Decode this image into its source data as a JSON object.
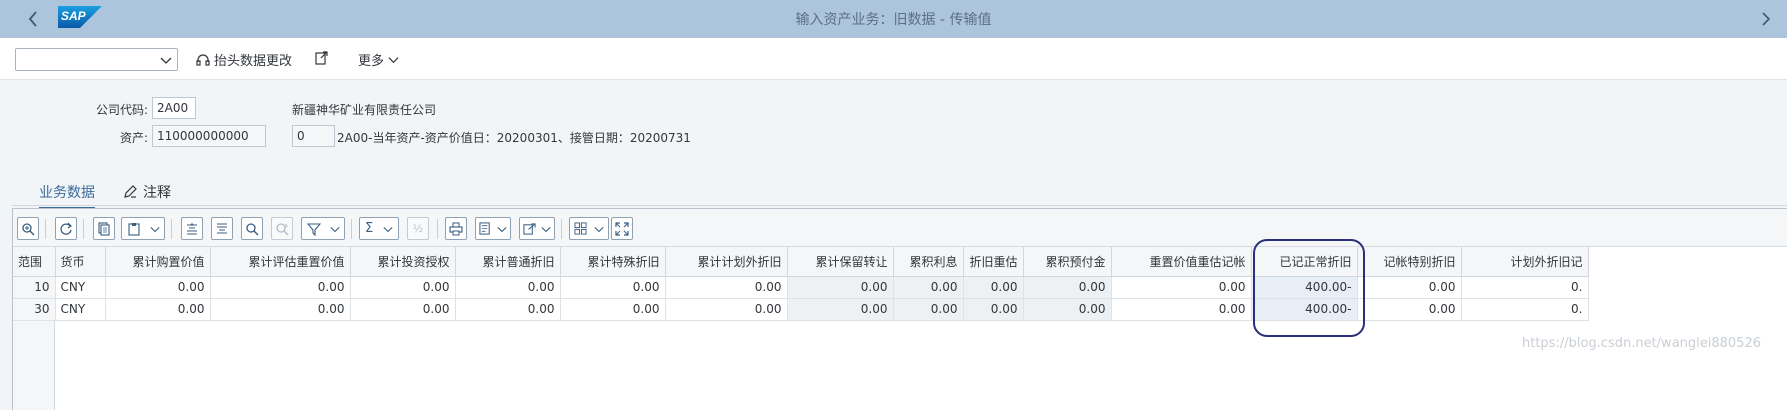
{
  "shell": {
    "title": "输入资产业务：旧数据 - 传输值",
    "logo": "SAP",
    "back_icon": "chevron-left-icon",
    "forward_icon": "chevron-right-icon"
  },
  "toolbar": {
    "dropdown_value": "",
    "header_change_label": "抬头数据更改",
    "more_label": "更多"
  },
  "form": {
    "company_code_label": "公司代码:",
    "company_code_value": "2A00",
    "company_name": "新疆神华矿业有限责任公司",
    "asset_label": "资产:",
    "asset_value": "110000000000",
    "sub_number": "0",
    "asset_desc": "2A00-当年资产-资产价值日：20200301、接管日期：20200731"
  },
  "tabs": [
    {
      "label": "业务数据",
      "active": true
    },
    {
      "label": "注释",
      "active": false
    }
  ],
  "grid": {
    "columns": [
      "范围",
      "货币",
      "累计购置价值",
      "累计评估重置价值",
      "累计投资授权",
      "累计普通折旧",
      "累计特殊折旧",
      "累计计划外折旧",
      "累计保留转让",
      "累积利息",
      "折旧重估",
      "累积预付金",
      "重置价值重估记帐",
      "已记正常折旧",
      "记帐特别折旧",
      "计划外折旧记"
    ],
    "rows": [
      [
        "10",
        "CNY",
        "0.00",
        "0.00",
        "0.00",
        "0.00",
        "0.00",
        "0.00",
        "0.00",
        "0.00",
        "0.00",
        "0.00",
        "0.00",
        "400.00-",
        "0.00",
        "0."
      ],
      [
        "30",
        "CNY",
        "0.00",
        "0.00",
        "0.00",
        "0.00",
        "0.00",
        "0.00",
        "0.00",
        "0.00",
        "0.00",
        "0.00",
        "0.00",
        "400.00-",
        "0.00",
        "0."
      ]
    ]
  },
  "watermark": "https://blog.csdn.net/wanglei880526",
  "colors": {
    "shell": "#acc5dd",
    "accent": "#3a6a9b",
    "ring": "#2b2f7a"
  }
}
